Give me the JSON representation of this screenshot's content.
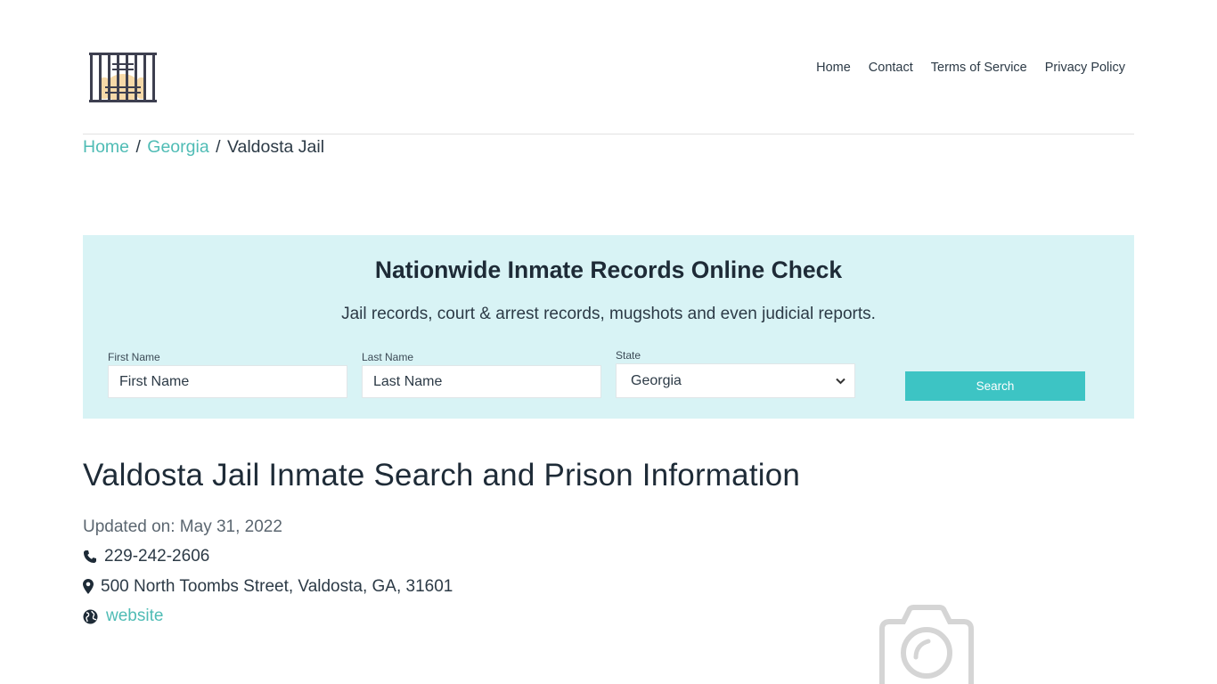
{
  "header": {
    "logo_icon": "jail-bars-logo",
    "nav": [
      {
        "label": "Home"
      },
      {
        "label": "Contact"
      },
      {
        "label": "Terms of Service"
      },
      {
        "label": "Privacy Policy"
      }
    ]
  },
  "breadcrumb": {
    "items": [
      {
        "label": "Home",
        "link": true
      },
      {
        "label": "Georgia",
        "link": true
      },
      {
        "label": "Valdosta Jail",
        "link": false
      }
    ],
    "separator": "/"
  },
  "search": {
    "title": "Nationwide Inmate Records Online Check",
    "subtitle": "Jail records, court & arrest records, mugshots and even judicial reports.",
    "first_name": {
      "label": "First Name",
      "placeholder": "First Name",
      "value": ""
    },
    "last_name": {
      "label": "Last Name",
      "placeholder": "Last Name",
      "value": ""
    },
    "state": {
      "label": "State",
      "selected": "Georgia"
    },
    "button_label": "Search",
    "background": "#d8f3f5",
    "button_color": "#3dc4c4"
  },
  "main": {
    "title": "Valdosta Jail Inmate Search and Prison Information",
    "updated": "Updated on: May 31, 2022",
    "phone": "229-242-2606",
    "address": "500 North Toombs Street, Valdosta, GA, 31601",
    "website_label": "website",
    "image_placeholder_icon": "camera-icon"
  },
  "colors": {
    "accent": "#4fbcb5",
    "text": "#1e2b37"
  }
}
